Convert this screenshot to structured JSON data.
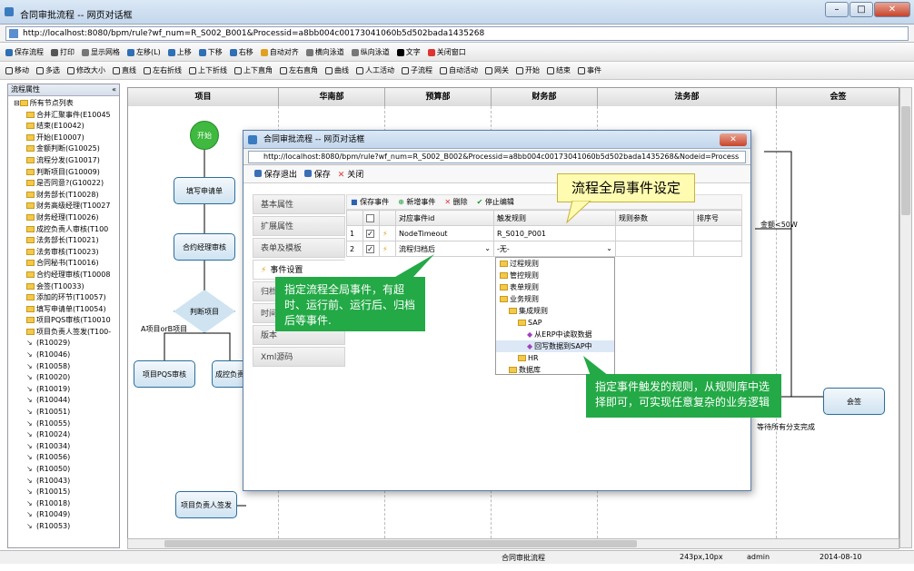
{
  "window": {
    "title": "合同审批流程 -- 网页对话框",
    "url": "http://localhost:8080/bpm/rule?wf_num=R_S002_B001&Processid=a8bb004c00173041060b5d502bada1435268"
  },
  "toolbar1": [
    "保存流程",
    "打印",
    "显示网格",
    "左移(L)",
    "上移",
    "下移",
    "右移",
    "自动对齐",
    "横向泳道",
    "纵向泳道",
    "文字",
    "关闭窗口"
  ],
  "toolbar2": [
    "移动",
    "多选",
    "修改大小",
    "直线",
    "左右折线",
    "上下折线",
    "上下直角",
    "左右直角",
    "曲线",
    "人工活动",
    "子流程",
    "自动活动",
    "网关",
    "开始",
    "结束",
    "事件"
  ],
  "sidebar": {
    "title": "流程属性",
    "root": "所有节点列表",
    "items": [
      "合并汇聚事件(E10045",
      "结束(E10042)",
      "开始(E10007)",
      "金额判断(G10025)",
      "流程分发(G10017)",
      "判断项目(G10009)",
      "是否同意?(G10022)",
      "财务部长(T10028)",
      "财务高级经理(T10027",
      "财务经理(T10026)",
      "成控负责人审核(T100",
      "法务部长(T10021)",
      "法务审核(T10023)",
      "合同秘书(T10016)",
      "合约经理审核(T10008",
      "会签(T10033)",
      "添加的环节(T10057)",
      "填写申请单(T10054)",
      "项目PQS审核(T10010",
      "项目负责人签发(T100-"
    ],
    "routes": [
      "(R10029)",
      "(R10046)",
      "(R10058)",
      "(R10020)",
      "(R10019)",
      "(R10044)",
      "(R10051)",
      "(R10055)",
      "(R10024)",
      "(R10034)",
      "(R10056)",
      "(R10050)",
      "(R10043)",
      "(R10015)",
      "(R10018)",
      "(R10049)",
      "(R10053)"
    ]
  },
  "lanes": [
    "项目",
    "华南部",
    "预算部",
    "财务部",
    "法务部",
    "会签"
  ],
  "nodes": {
    "start": "开始",
    "fill": "填写申请单",
    "contract": "合约经理审核",
    "judge": "判断项目",
    "pqs": "项目PQS审核",
    "cost": "成控负责",
    "sign": "项目负责人签发",
    "huiqian": "会签"
  },
  "edge_labels": {
    "ab": "A项目orB项目",
    "amount": "金额<50W",
    "wait": "等待所有分支完成"
  },
  "dialog": {
    "title": "合同审批流程 -- 网页对话框",
    "url": "http://localhost:8080/bpm/rule?wf_num=R_S002_B002&Processid=a8bb004c00173041060b5d502bada1435268&Nodeid=Process",
    "toolbar": [
      "保存退出",
      "保存",
      "关闭"
    ],
    "tabs": [
      "基本属性",
      "扩展属性",
      "表单及模板",
      "事件设置",
      "归档",
      "时间",
      "版本",
      "Xml源码"
    ],
    "grid_toolbar": [
      "保存事件",
      "新增事件",
      "删除",
      "停止编辑"
    ],
    "columns": [
      "对应事件id",
      "触发规则",
      "规则参数",
      "排序号"
    ],
    "rows": [
      {
        "no": "1",
        "event": "NodeTimeout",
        "rule": "R_S010_P001"
      },
      {
        "no": "2",
        "event": "流程归档后",
        "rule": "-无-"
      }
    ],
    "tree": [
      "过程规则",
      "管控规则",
      "表单规则",
      "业务规则",
      "集成规则",
      "SAP",
      "从ERP中读取数据",
      "回写数据到SAP中",
      "HR",
      "数据库"
    ]
  },
  "callouts": {
    "title": "流程全局事件设定",
    "left": "指定流程全局事件，有超时、运行前、运行后、归档后等事件.",
    "right": "指定事件触发的规则，从规则库中选择即可，可实现任意复杂的业务逻辑"
  },
  "status": {
    "name": "合同审批流程",
    "pos": "243px,10px",
    "user": "admin",
    "date": "2014-08-10"
  }
}
